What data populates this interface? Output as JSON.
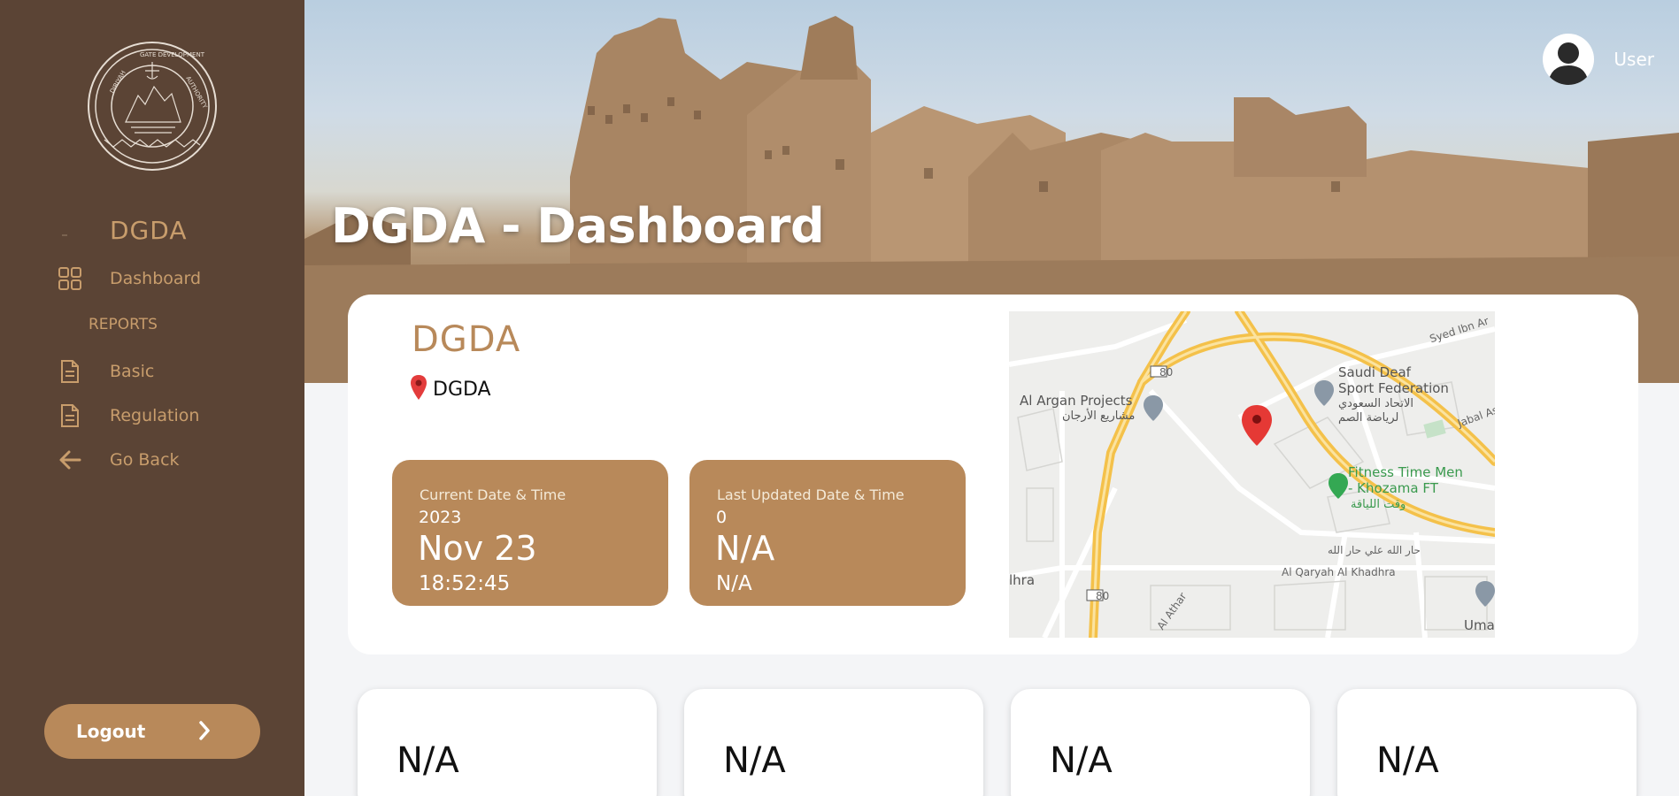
{
  "sidebar": {
    "logo_icon": "dgda-seal-logo",
    "brand": "DGDA",
    "items": [
      {
        "label": "Dashboard",
        "icon": "grid-icon"
      },
      {
        "label": "Basic",
        "icon": "document-icon"
      },
      {
        "label": "Regulation",
        "icon": "document-icon"
      },
      {
        "label": "Go Back",
        "icon": "arrow-left-icon"
      }
    ],
    "section": "REPORTS",
    "logout_label": "Logout"
  },
  "header": {
    "title": "DGDA - Dashboard",
    "user_label": "User"
  },
  "site": {
    "title": "DGDA",
    "location": "DGDA"
  },
  "current_tile": {
    "label": "Current Date & Time",
    "year": "2023",
    "date": "Nov 23",
    "time": "18:52:45"
  },
  "updated_tile": {
    "label": "Last Updated Date & Time",
    "year": "0",
    "date": "N/A",
    "time": "N/A"
  },
  "map": {
    "labels": {
      "al_argan": "Al Argan Projects",
      "al_argan_ar": "مشاريع الأرجان",
      "saudi_deaf_1": "Saudi Deaf",
      "saudi_deaf_2": "Sport Federation",
      "saudi_deaf_ar1": "الاتحاد السعودي",
      "saudi_deaf_ar2": "لرياضة الصم",
      "fitness_1": "Fitness Time Men",
      "fitness_2": "- Khozama FT",
      "fitness_ar": "وقت اللياقة",
      "syed": "Syed Ibn Ar",
      "jabal": "Jabal As",
      "qaryah": "Al Qaryah Al Khadhra",
      "athar": "Al Athar",
      "umar": "Umar B",
      "hra": "lhra",
      "ali_ar": "حار الله علي حار الله",
      "road80": "80"
    }
  },
  "stats": [
    {
      "value": "N/A"
    },
    {
      "value": "N/A"
    },
    {
      "value": "N/A"
    },
    {
      "value": "N/A"
    }
  ],
  "colors": {
    "sidebar": "#5b4435",
    "accent": "#b8895a",
    "accent_text": "#c89d6c"
  }
}
